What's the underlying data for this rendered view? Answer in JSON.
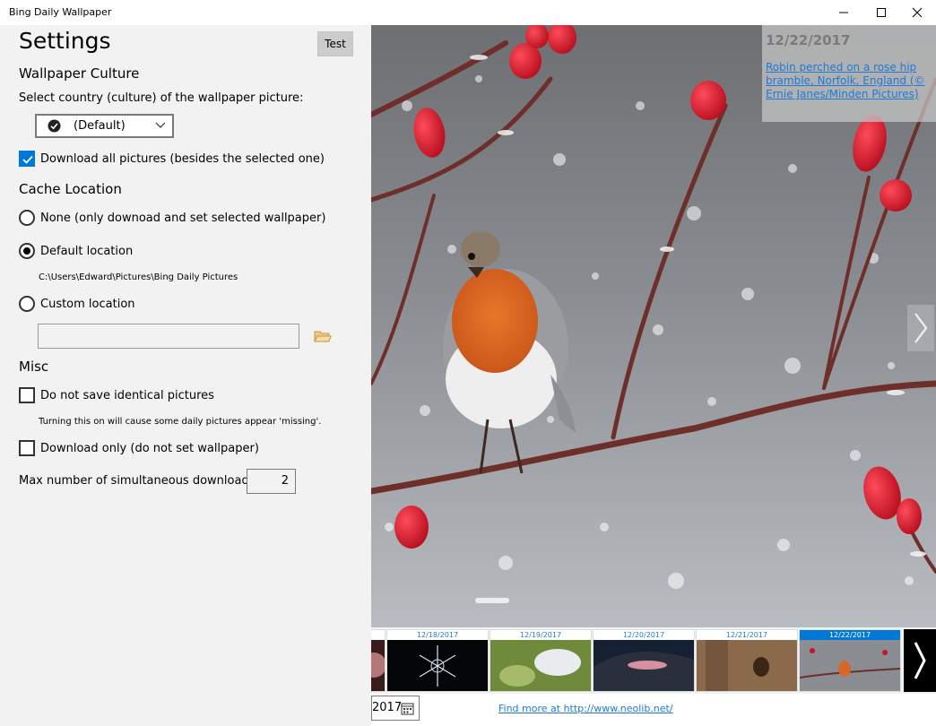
{
  "window": {
    "title": "Bing Daily Wallpaper"
  },
  "settings": {
    "title": "Settings",
    "test_label": "Test",
    "culture": {
      "heading": "Wallpaper Culture",
      "select_label": "Select country (culture) of the wallpaper picture:",
      "selected_value": "(Default)"
    },
    "download_all": {
      "label": "Download all pictures (besides the selected one)",
      "checked": true
    },
    "cache": {
      "heading": "Cache Location",
      "options": [
        {
          "label": "None (only downoad and set selected wallpaper)",
          "selected": false
        },
        {
          "label": "Default location",
          "selected": true
        },
        {
          "label": "Custom location",
          "selected": false
        }
      ],
      "default_path": "C:\\Users\\Edward\\Pictures\\Bing Daily Pictures",
      "custom_path_value": ""
    },
    "misc": {
      "heading": "Misc",
      "no_identical": {
        "label": "Do not save identical pictures",
        "checked": false
      },
      "no_identical_hint": "Turning this on will cause some daily pictures appear 'missing'.",
      "download_only": {
        "label": "Download only (do not set wallpaper)",
        "checked": false
      },
      "max_downloads_label": "Max number of simultaneous downloads:",
      "max_downloads_value": "2"
    }
  },
  "viewer": {
    "date": "12/22/2017",
    "description": "Robin perched on a rose hip bramble, Norfolk, England (© Ernie Janes/Minden Pictures)"
  },
  "thumbnails": [
    {
      "date": "",
      "selected": false
    },
    {
      "date": "12/18/2017",
      "selected": false
    },
    {
      "date": "12/19/2017",
      "selected": false
    },
    {
      "date": "12/20/2017",
      "selected": false
    },
    {
      "date": "12/21/2017",
      "selected": false
    },
    {
      "date": "12/22/2017",
      "selected": true
    }
  ],
  "bottom": {
    "year_value": "2017",
    "find_more": "Find more at http://www.neolib.net/"
  },
  "colors": {
    "accent": "#0078d7",
    "link": "#1e7bd6",
    "panel_bg": "#f2f2f2"
  },
  "icons": [
    "minimize-icon",
    "maximize-icon",
    "close-icon",
    "check-circle-icon",
    "chevron-down-icon",
    "checkmark-icon",
    "folder-icon",
    "chevron-right-icon",
    "calendar-icon"
  ]
}
